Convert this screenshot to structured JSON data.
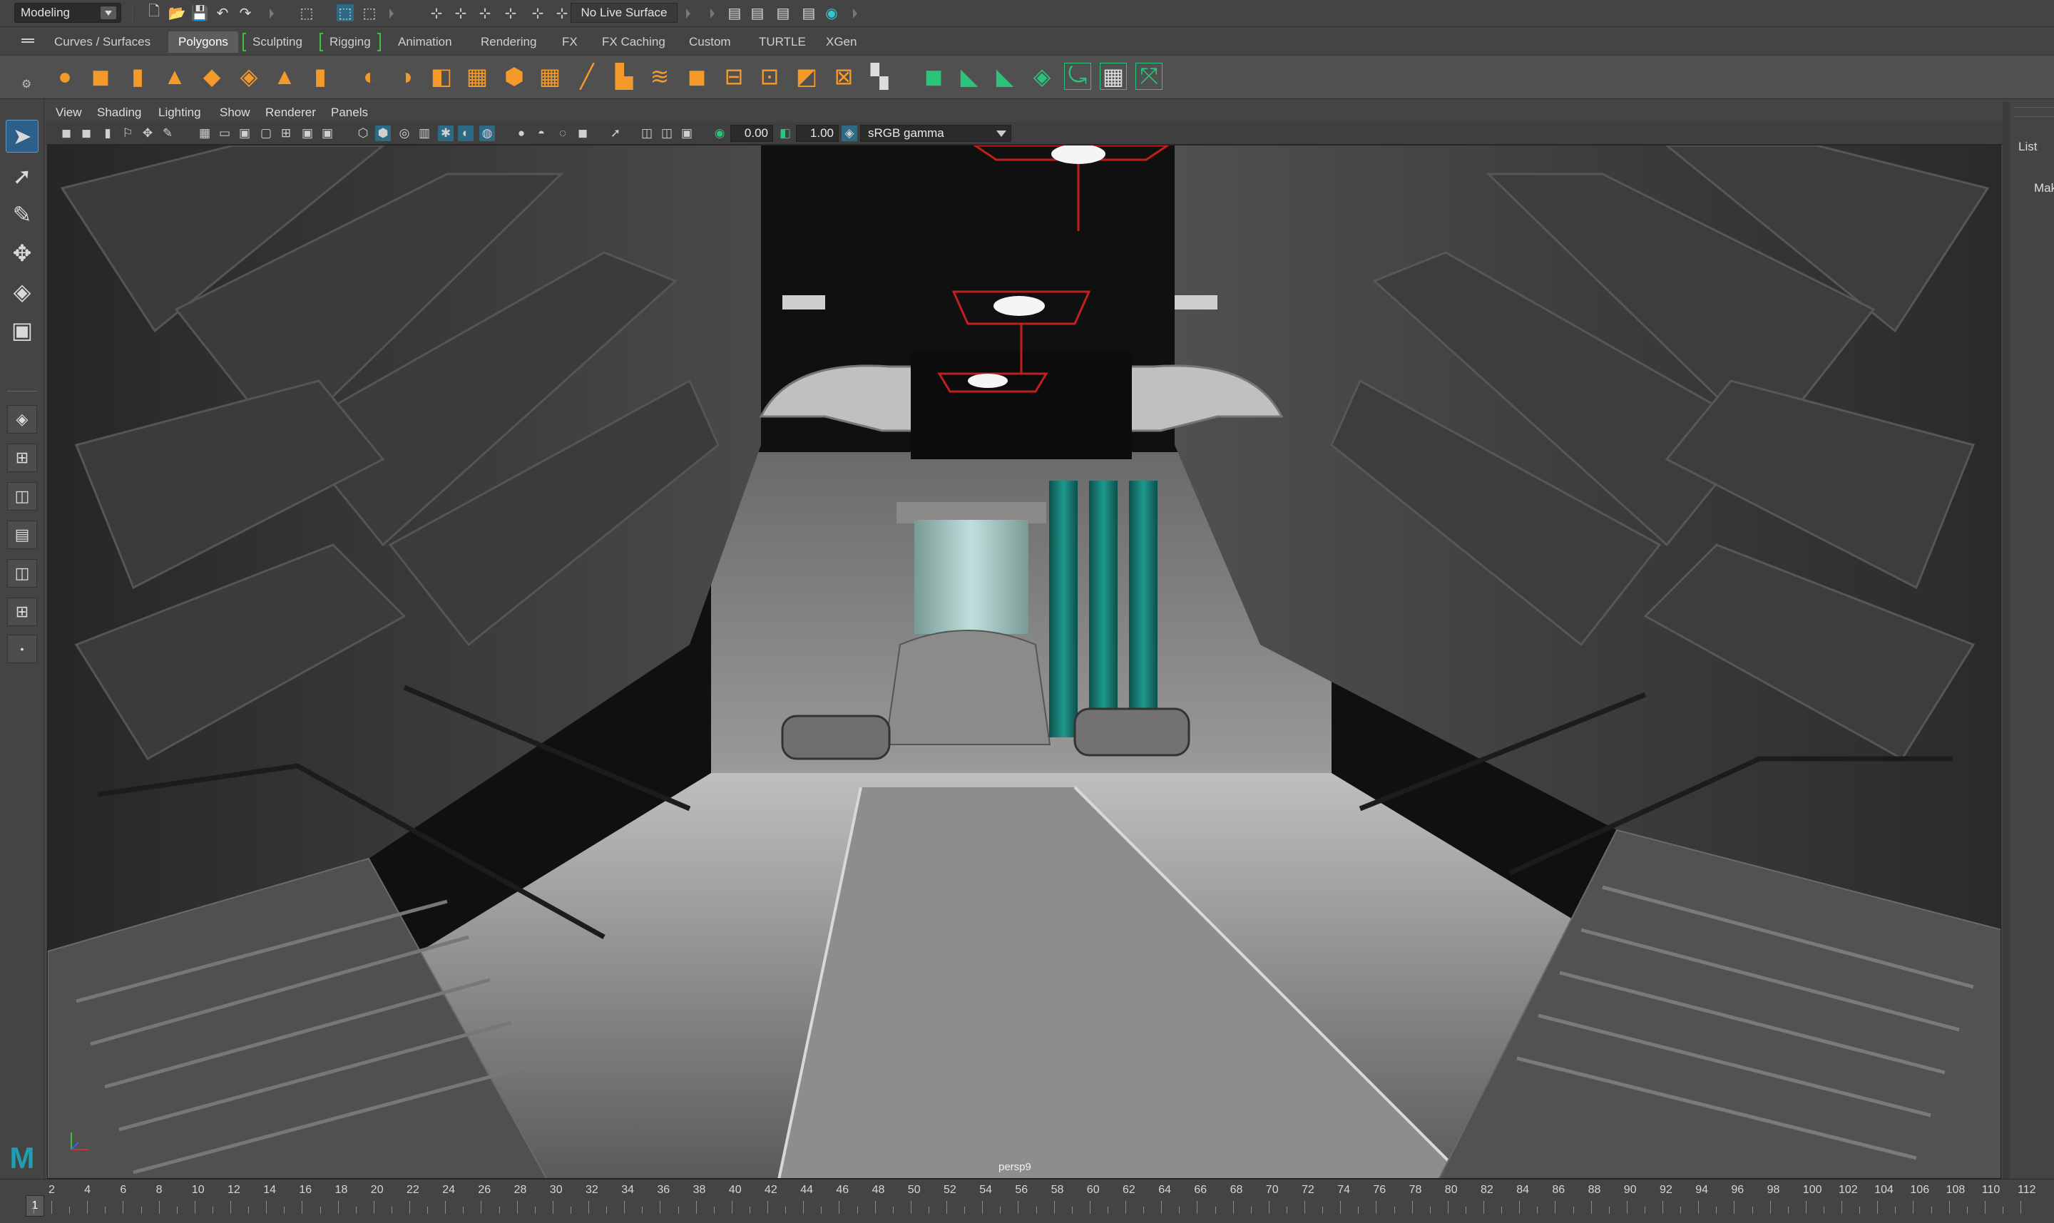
{
  "statusline": {
    "menuset": "Modeling",
    "live_surface": "No Live Surface"
  },
  "shelf_tabs": [
    "Curves / Surfaces",
    "Polygons",
    "Sculpting",
    "Rigging",
    "Animation",
    "Rendering",
    "FX",
    "FX Caching",
    "Custom",
    "TURTLE",
    "XGen"
  ],
  "active_shelf_tab": "Polygons",
  "viewport": {
    "menus": [
      "View",
      "Shading",
      "Lighting",
      "Show",
      "Renderer",
      "Panels"
    ],
    "exposure": "0.00",
    "gamma": "1.00",
    "color_space": "sRGB gamma",
    "camera_label": "persp9"
  },
  "right_panel": {
    "list_label": "List",
    "make_label": "Mak"
  },
  "timeline": {
    "current_frame": "1",
    "ticks": [
      "2",
      "4",
      "6",
      "8",
      "10",
      "12",
      "14",
      "16",
      "18",
      "20",
      "22",
      "24",
      "26",
      "28",
      "30",
      "32",
      "34",
      "36",
      "38",
      "40",
      "42",
      "44",
      "46",
      "48",
      "50",
      "52",
      "54",
      "56",
      "58",
      "60",
      "62",
      "64",
      "66",
      "68",
      "70",
      "72",
      "74",
      "76",
      "78",
      "80",
      "82",
      "84",
      "86",
      "88",
      "90",
      "92",
      "94",
      "96",
      "98",
      "100",
      "102",
      "104",
      "106",
      "108",
      "110",
      "112"
    ]
  },
  "colors": {
    "accent_select": "#2c5f8a",
    "shelf_orange": "#f39a2b",
    "shelf_green": "#2bc47a",
    "pillar_teal": "#1f8a80",
    "light_red": "#c0201c"
  }
}
